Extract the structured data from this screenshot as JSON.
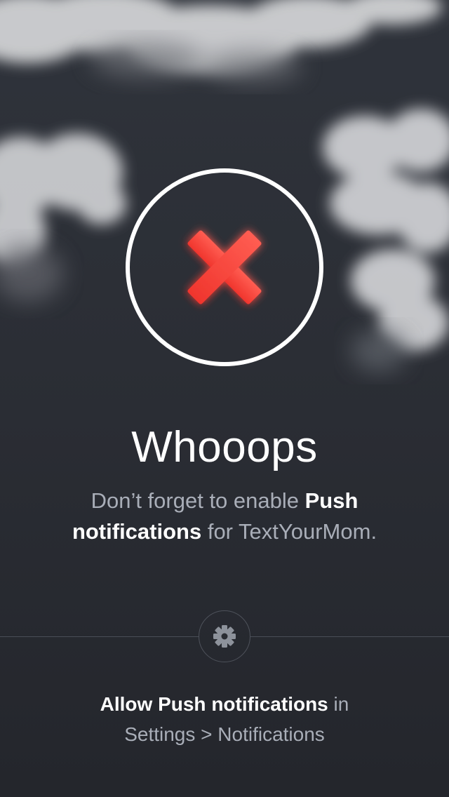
{
  "alert": {
    "icon": "cross-icon",
    "icon_color": "#ff3b30",
    "title": "Whooops",
    "message": {
      "part1": "Don’t forget to enable ",
      "bold": "Push notifications",
      "part2": " for TextYourMom."
    }
  },
  "settings": {
    "icon": "gear-icon",
    "instruction": {
      "bold": "Allow Push notifications",
      "part1": " in",
      "path": "Settings > Notifications"
    }
  },
  "colors": {
    "background": "#2c2f36",
    "accent": "#ff3b30",
    "text_primary": "#ffffff",
    "text_secondary": "#a9aeb8"
  }
}
